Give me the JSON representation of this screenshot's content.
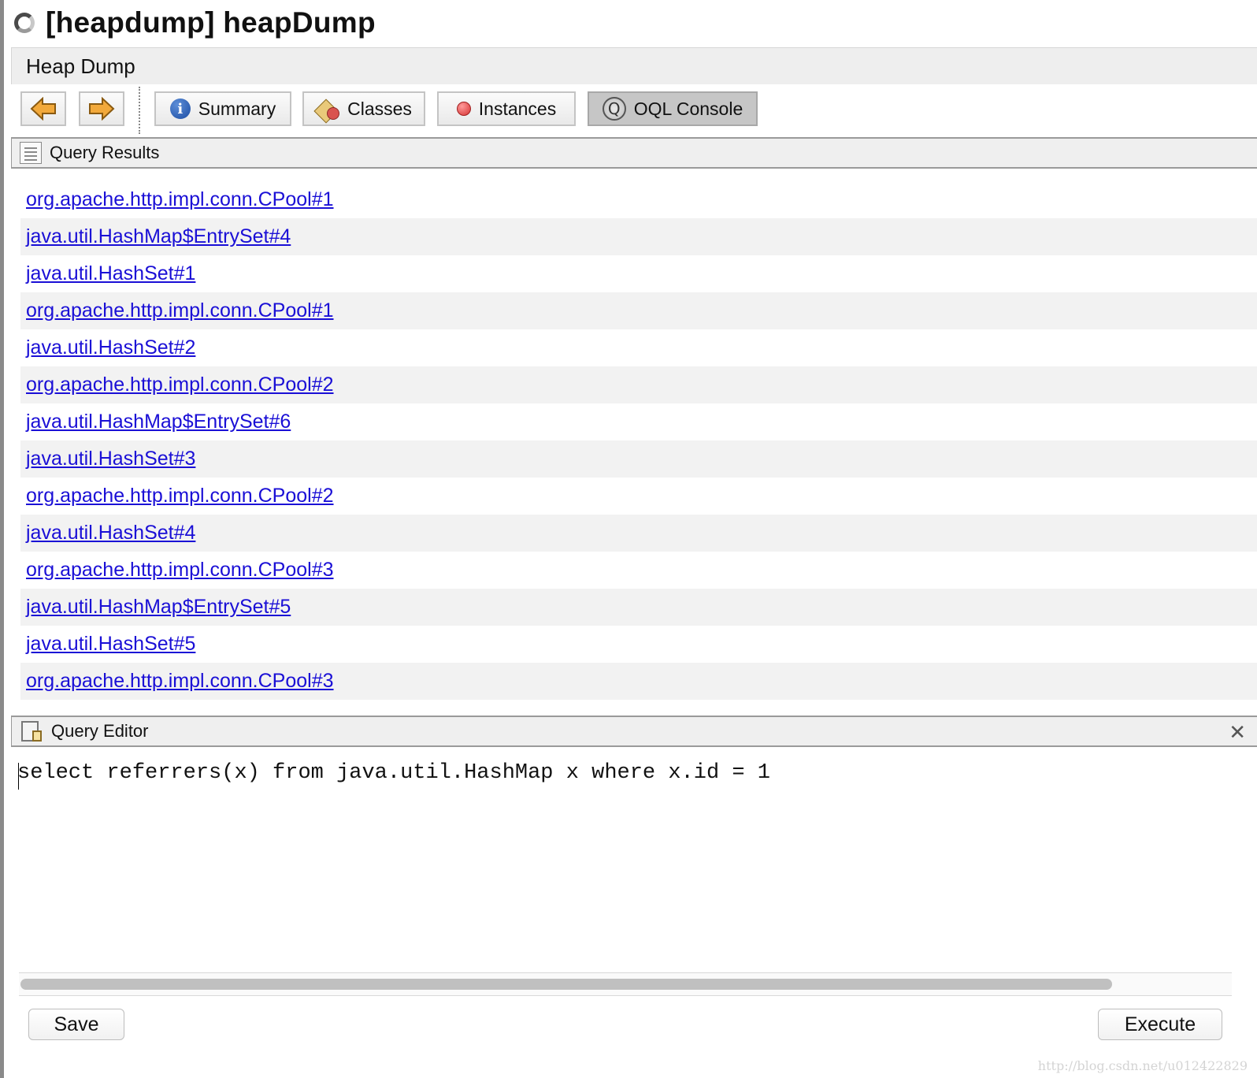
{
  "window": {
    "title": "[heapdump] heapDump"
  },
  "tab": {
    "label": "Heap Dump"
  },
  "toolbar": {
    "back_icon": "arrow-left-icon",
    "forward_icon": "arrow-right-icon",
    "buttons": [
      {
        "label": "Summary",
        "icon": "info-icon"
      },
      {
        "label": "Classes",
        "icon": "classes-icon"
      },
      {
        "label": "Instances",
        "icon": "instance-icon"
      },
      {
        "label": "OQL Console",
        "icon": "oql-icon",
        "active": true
      }
    ]
  },
  "results": {
    "title": "Query Results",
    "items": [
      "org.apache.http.impl.conn.CPool#1",
      "java.util.HashMap$EntrySet#4",
      "java.util.HashSet#1",
      "org.apache.http.impl.conn.CPool#1",
      "java.util.HashSet#2",
      "org.apache.http.impl.conn.CPool#2",
      "java.util.HashMap$EntrySet#6",
      "java.util.HashSet#3",
      "org.apache.http.impl.conn.CPool#2",
      "java.util.HashSet#4",
      "org.apache.http.impl.conn.CPool#3",
      "java.util.HashMap$EntrySet#5",
      "java.util.HashSet#5",
      "org.apache.http.impl.conn.CPool#3"
    ]
  },
  "editor": {
    "title": "Query Editor",
    "query": "select referrers(x) from java.util.HashMap x where x.id = 1",
    "close_glyph": "✕"
  },
  "actions": {
    "save": "Save",
    "execute": "Execute"
  },
  "watermark": "http://blog.csdn.net/u012422829",
  "colors": {
    "link": "#1a0fd6",
    "active_tab": "#c6c6c6",
    "arrow_fill": "#f2a93b"
  }
}
